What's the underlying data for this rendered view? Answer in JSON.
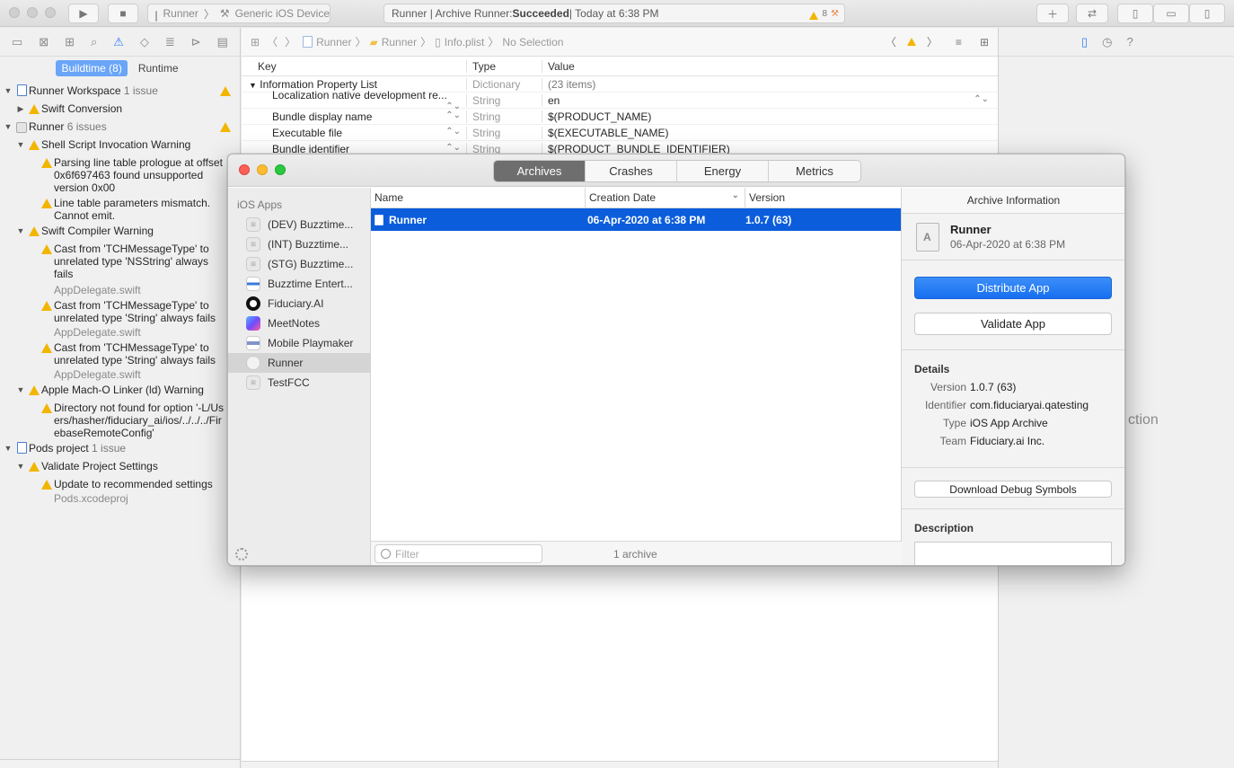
{
  "toolbar": {
    "scheme_name": "Runner",
    "device": "Generic iOS Device",
    "activity_prefix": "Runner | Archive Runner: ",
    "activity_status": "Succeeded",
    "activity_suffix": " | Today at 6:38 PM",
    "warning_count": "8"
  },
  "navigator": {
    "segments": {
      "buildtime": "Buildtime (8)",
      "runtime": "Runtime"
    },
    "rows": [
      {
        "label": "Runner Workspace",
        "badge": "1 issue"
      },
      {
        "label": "Swift Conversion"
      },
      {
        "label": "Runner",
        "badge": "6 issues"
      },
      {
        "label": "Shell Script Invocation Warning"
      },
      {
        "label": "Parsing line table prologue at offset 0x6f697463 found unsupported version 0x00"
      },
      {
        "label": "Line table parameters mismatch. Cannot emit."
      },
      {
        "label": "Swift Compiler Warning"
      },
      {
        "label": "Cast from 'TCHMessageType' to unrelated type 'NSString' always fails",
        "file": "AppDelegate.swift"
      },
      {
        "label": "Cast from 'TCHMessageType' to unrelated type 'String' always fails",
        "file": "AppDelegate.swift"
      },
      {
        "label": "Cast from 'TCHMessageType' to unrelated type 'String' always fails",
        "file": "AppDelegate.swift"
      },
      {
        "label": "Apple Mach-O Linker (ld) Warning"
      },
      {
        "label": "Directory not found for option '-L/Users/hasher/fiduciary_ai/ios/../../../FirebaseRemoteConfig'"
      },
      {
        "label": "Pods project",
        "badge": "1 issue"
      },
      {
        "label": "Validate Project Settings"
      },
      {
        "label": "Update to recommended settings",
        "file": "Pods.xcodeproj"
      }
    ]
  },
  "editor": {
    "breadcrumbs": [
      "Runner",
      "Runner",
      "Info.plist",
      "No Selection"
    ],
    "columns": {
      "key": "Key",
      "type": "Type",
      "value": "Value"
    },
    "root": {
      "key": "Information Property List",
      "type": "Dictionary",
      "value": "(23 items)"
    },
    "rows": [
      {
        "key": "Localization native development re...",
        "type": "String",
        "value": "en"
      },
      {
        "key": "Bundle display name",
        "type": "String",
        "value": "$(PRODUCT_NAME)"
      },
      {
        "key": "Executable file",
        "type": "String",
        "value": "$(EXECUTABLE_NAME)"
      },
      {
        "key": "Bundle identifier",
        "type": "String",
        "value": "$(PRODUCT_BUNDLE_IDENTIFIER)"
      }
    ]
  },
  "inspector": {
    "ghost_text": "ction"
  },
  "organizer": {
    "tabs": [
      "Archives",
      "Crashes",
      "Energy",
      "Metrics"
    ],
    "sidebar_header": "iOS Apps",
    "apps": [
      "(DEV) Buzztime...",
      "(INT) Buzztime...",
      "(STG) Buzztime...",
      "Buzztime Entert...",
      "Fiduciary.AI",
      "MeetNotes",
      "Mobile Playmaker",
      "Runner",
      "TestFCC"
    ],
    "columns": {
      "name": "Name",
      "date": "Creation Date",
      "version": "Version"
    },
    "archive": {
      "name": "Runner",
      "date": "06-Apr-2020 at 6:38 PM",
      "version": "1.0.7 (63)"
    },
    "filter_placeholder": "Filter",
    "archive_count": "1 archive",
    "info": {
      "title": "Archive Information",
      "name": "Runner",
      "date": "06-Apr-2020 at 6:38 PM",
      "distribute": "Distribute App",
      "validate": "Validate App",
      "details_title": "Details",
      "details": [
        {
          "k": "Version",
          "v": "1.0.7 (63)"
        },
        {
          "k": "Identifier",
          "v": "com.fiduciaryai.qatesting"
        },
        {
          "k": "Type",
          "v": "iOS App Archive"
        },
        {
          "k": "Team",
          "v": "Fiduciary.ai Inc."
        }
      ],
      "download_symbols": "Download Debug Symbols",
      "description_title": "Description"
    }
  }
}
